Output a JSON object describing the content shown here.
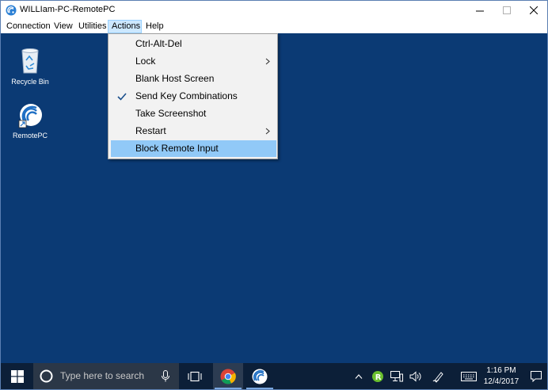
{
  "window": {
    "title": "WILLIam-PC-RemotePC"
  },
  "menubar": {
    "items": [
      "Connection",
      "View",
      "Utilities",
      "Actions",
      "Help"
    ],
    "active": "Actions"
  },
  "actions_menu": {
    "items": [
      {
        "label": "Ctrl-Alt-Del"
      },
      {
        "label": "Lock",
        "submenu": true
      },
      {
        "label": "Blank Host Screen"
      },
      {
        "label": "Send Key Combinations",
        "checked": true
      },
      {
        "label": "Take Screenshot"
      },
      {
        "label": "Restart",
        "submenu": true
      },
      {
        "label": "Block Remote Input",
        "highlighted": true
      }
    ]
  },
  "desktop": {
    "icons": [
      {
        "label": "Recycle Bin",
        "icon": "recycle-bin-icon"
      },
      {
        "label": "RemotePC",
        "icon": "remotepc-icon"
      }
    ]
  },
  "taskbar": {
    "search_placeholder": "Type here to search",
    "clock": {
      "time": "1:16 PM",
      "date": "12/4/2017"
    }
  },
  "colors": {
    "desktop": "#0b3a74",
    "taskbar": "#0c1f38",
    "menu_highlight": "#91c9f7",
    "menubar_active": "#cce8ff"
  }
}
